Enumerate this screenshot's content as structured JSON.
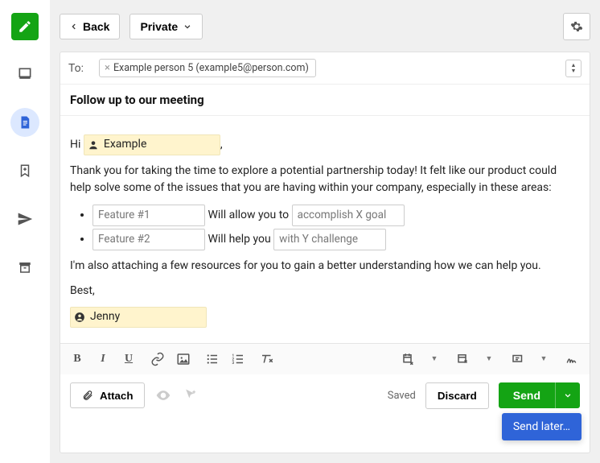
{
  "topbar": {
    "back_label": "Back",
    "privacy_label": "Private"
  },
  "to": {
    "label": "To:",
    "recipient": "Example person 5 (example5@person.com)"
  },
  "subject": "Follow up to our meeting",
  "body": {
    "greeting_prefix": "Hi",
    "greeting_token": "Example",
    "p1": "Thank you for taking the time to explore a potential partnership today! It felt like our product could help solve some of the issues that you are having within your company, especially in these areas:",
    "bullets": [
      {
        "feature": "Feature #1",
        "mid": "Will allow you to",
        "goal": "accomplish X goal"
      },
      {
        "feature": "Feature #2",
        "mid": "Will help you",
        "goal": "with Y challenge"
      }
    ],
    "p2": "I'm also attaching a few resources for you to gain a better understanding how we can help you.",
    "signoff": "Best,",
    "signature_token": "Jenny"
  },
  "bottom": {
    "attach": "Attach",
    "saved": "Saved",
    "discard": "Discard",
    "send": "Send",
    "send_later": "Send later…"
  }
}
